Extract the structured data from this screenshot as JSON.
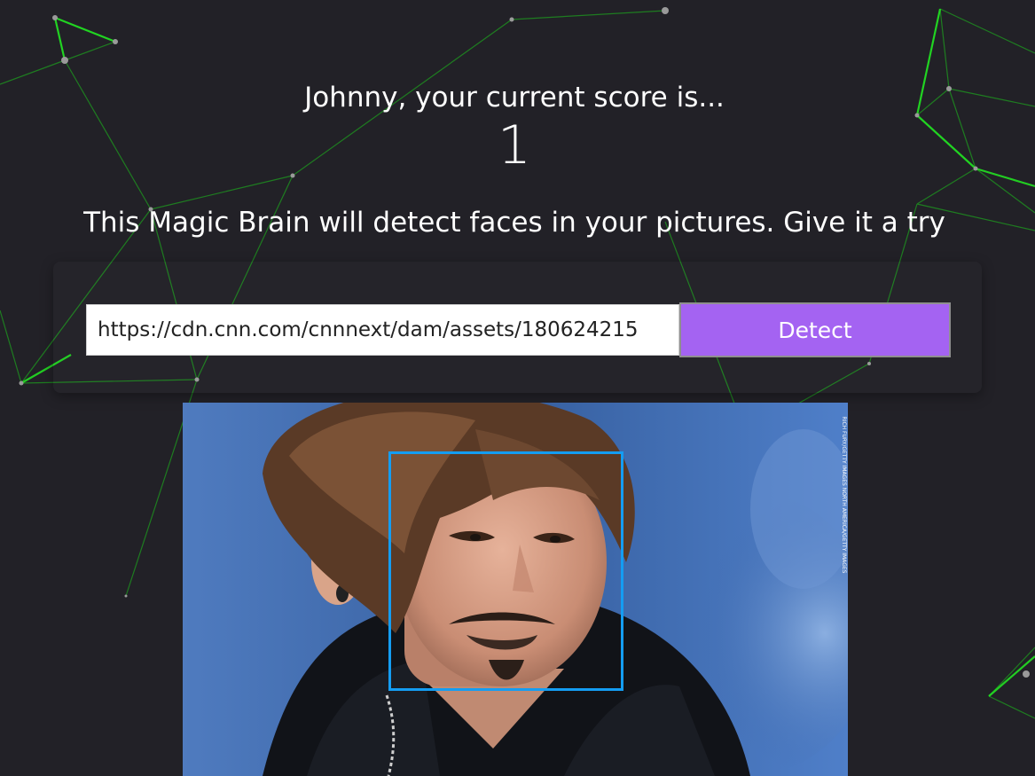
{
  "rank": {
    "heading": "Johnny, your current score is...",
    "value": "1"
  },
  "tagline": "This Magic Brain will detect faces in your pictures. Give it a try",
  "form": {
    "url_value": "https://cdn.cnn.com/cnnnext/dam/assets/180624215",
    "detect_label": "Detect"
  },
  "image": {
    "credit": "RICH FURY/GETTY IMAGES NORTH AMERICA/GETTY IMAGES"
  },
  "colors": {
    "background": "#222127",
    "particle_line": "#1cc91c",
    "button": "#a463f2",
    "face_box": "#149df2"
  },
  "icons": {
    "face_box": "bounding-box",
    "background": "particle-network"
  }
}
